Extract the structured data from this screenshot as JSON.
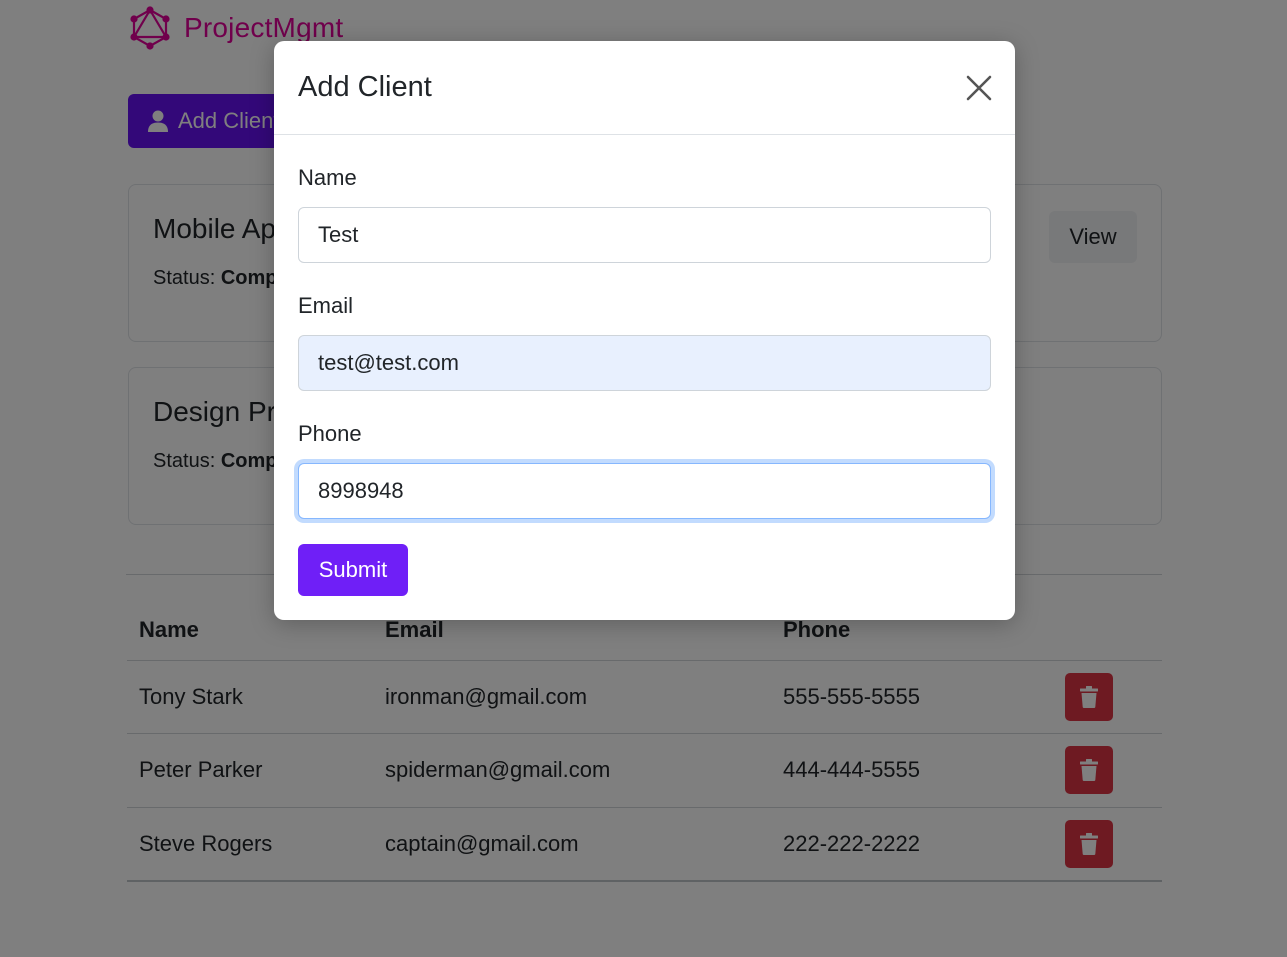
{
  "app": {
    "brand_name": "ProjectMgmt",
    "add_client_label": "Add Client"
  },
  "projects": [
    {
      "title": "Mobile App",
      "status_label": "Status:",
      "status_value": "Completed",
      "view_label": "View"
    },
    {
      "title": "Design Project",
      "status_label": "Status:",
      "status_value": "Completed"
    }
  ],
  "clients_table": {
    "headers": {
      "name": "Name",
      "email": "Email",
      "phone": "Phone"
    },
    "rows": [
      {
        "name": "Tony Stark",
        "email": "ironman@gmail.com",
        "phone": "555-555-5555"
      },
      {
        "name": "Peter Parker",
        "email": "spiderman@gmail.com",
        "phone": "444-444-5555"
      },
      {
        "name": "Steve Rogers",
        "email": "captain@gmail.com",
        "phone": "222-222-2222"
      }
    ]
  },
  "modal": {
    "title": "Add Client",
    "fields": {
      "name": {
        "label": "Name",
        "value": "Test"
      },
      "email": {
        "label": "Email",
        "value": "test@test.com"
      },
      "phone": {
        "label": "Phone",
        "value": "8998948"
      }
    },
    "submit_label": "Submit"
  },
  "colors": {
    "brand": "#e10098",
    "primary_button": "#6610f2",
    "submit_button": "#6f1ff7",
    "delete_button": "#dc3545",
    "autofill_background": "#e8f0fe"
  },
  "icons": {
    "brand": "graphql-logo-icon",
    "add_client": "user-icon",
    "close": "close-icon",
    "delete": "trash-icon"
  }
}
